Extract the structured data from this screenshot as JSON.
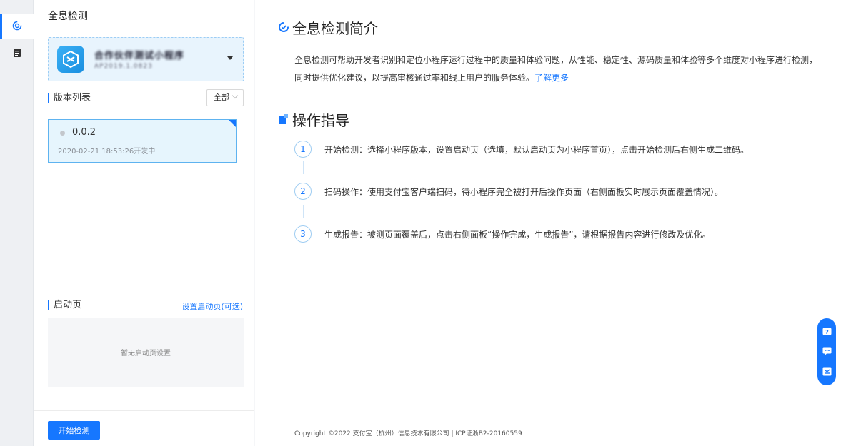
{
  "panel": {
    "title": "全息检测",
    "app_selector": {
      "name": "合作伙伴测试小程序",
      "id": "AP2019.1.0823"
    },
    "version_list": {
      "label": "版本列表",
      "filter_value": "全部",
      "versions": [
        {
          "number": "0.0.2",
          "time": "2020-02-21 18:53:26开发中"
        }
      ]
    },
    "startpage": {
      "label": "启动页",
      "link": "设置启动页(可选)",
      "empty_text": "暂无启动页设置"
    },
    "start_button": "开始检测"
  },
  "main": {
    "intro_title": "全息检测简介",
    "intro_text": "全息检测可帮助开发者识别和定位小程序运行过程中的质量和体验问题，从性能、稳定性、源码质量和体验等多个维度对小程序进行检测，同时提供优化建议，以提高审核通过率和线上用户的服务体验。",
    "learn_more": "了解更多",
    "guide_title": "操作指导",
    "steps": [
      {
        "num": "1",
        "text": "开始检测：选择小程序版本，设置启动页（选填，默认启动页为小程序首页），点击开始检测后右侧生成二维码。"
      },
      {
        "num": "2",
        "text": "扫码操作：使用支付宝客户端扫码，待小程序完全被打开后操作页面（右侧面板实时展示页面覆盖情况）。"
      },
      {
        "num": "3",
        "text": "生成报告：被测页面覆盖后，点击右侧面板“操作完成，生成报告”，请根据报告内容进行修改及优化。"
      }
    ],
    "footer": "Copyright ©2022 支付宝（杭州）信息技术有限公司  |  ICP证浙B2-20160559"
  },
  "colors": {
    "accent": "#1677ff",
    "selected_bg": "#e6f5fd"
  }
}
